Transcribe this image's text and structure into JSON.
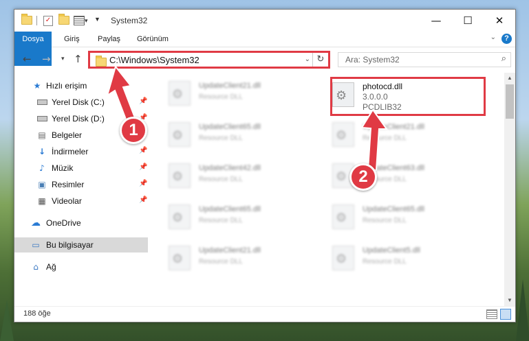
{
  "window": {
    "title": "System32",
    "controls": {
      "minimize": "—",
      "maximize": "☐",
      "close": "✕"
    }
  },
  "ribbon": {
    "tabs": [
      "Dosya",
      "Giriş",
      "Paylaş",
      "Görünüm"
    ],
    "help": "?"
  },
  "address": {
    "path": "C:\\Windows\\System32",
    "refresh_glyph": "↻",
    "dropdown_glyph": "⌄"
  },
  "search": {
    "placeholder": "Ara: System32",
    "icon": "search-icon"
  },
  "nav_pane": {
    "quick_access": "Hızlı erişim",
    "items": [
      {
        "label": "Yerel Disk (C:)",
        "icon": "drive-icon",
        "pinned": true
      },
      {
        "label": "Yerel Disk (D:)",
        "icon": "drive-icon",
        "pinned": true
      },
      {
        "label": "Belgeler",
        "icon": "documents-icon",
        "pinned": true
      },
      {
        "label": "İndirmeler",
        "icon": "downloads-icon",
        "pinned": true
      },
      {
        "label": "Müzik",
        "icon": "music-icon",
        "pinned": true
      },
      {
        "label": "Resimler",
        "icon": "pictures-icon",
        "pinned": true
      },
      {
        "label": "Videolar",
        "icon": "videos-icon",
        "pinned": true
      }
    ],
    "onedrive": "OneDrive",
    "this_pc": "Bu bilgisayar",
    "network": "Ağ"
  },
  "files": {
    "highlighted": {
      "name": "photocd.dll",
      "version": "3.0.0.0",
      "company": "PCDLIB32"
    },
    "background": [
      {
        "name": "UpdateClient21.dll",
        "desc": "Resource DLL"
      },
      {
        "name": "UpdateClient65.dll",
        "desc": "Resource DLL"
      },
      {
        "name": "UpdateClient21.dll",
        "desc": "Resource DLL"
      },
      {
        "name": "UpdateClient42.dll",
        "desc": "Resource DLL"
      },
      {
        "name": "UpdateClient63.dll",
        "desc": "Resource DLL"
      },
      {
        "name": "UpdateClient65.dll",
        "desc": "Resource DLL"
      },
      {
        "name": "UpdateClient65.dll",
        "desc": "Resource DLL"
      },
      {
        "name": "UpdateClient21.dll",
        "desc": "Resource DLL"
      },
      {
        "name": "UpdateClient5.dll",
        "desc": "Resource DLL"
      }
    ]
  },
  "status": {
    "item_count": "188 öğe"
  },
  "annotations": {
    "step1": "1",
    "step2": "2"
  },
  "colors": {
    "accent": "#1979ca",
    "annotation": "#e03a44",
    "selected": "#d9d9d9"
  }
}
